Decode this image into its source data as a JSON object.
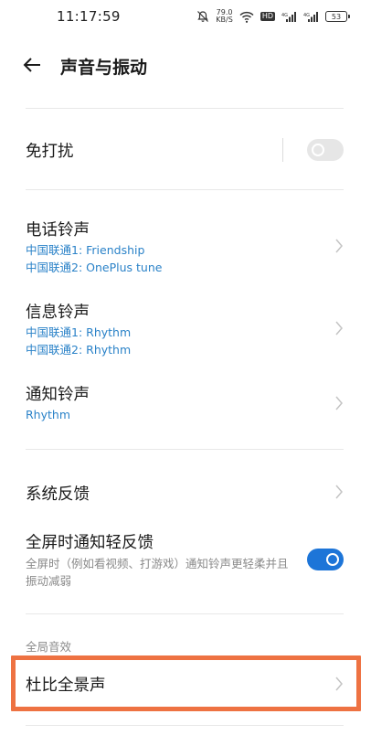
{
  "status_bar": {
    "time": "11:17:59",
    "net_speed_value": "79.0",
    "net_speed_unit": "KB/S",
    "hd_label": "HD",
    "battery_level": "53"
  },
  "header": {
    "title": "声音与振动"
  },
  "rows": {
    "dnd": {
      "title": "免打扰",
      "enabled": false
    },
    "phone_ringtone": {
      "title": "电话铃声",
      "sim1": "中国联通1: Friendship",
      "sim2": "中国联通2: OnePlus tune"
    },
    "message_ringtone": {
      "title": "信息铃声",
      "sim1": "中国联通1: Rhythm",
      "sim2": "中国联通2: Rhythm"
    },
    "notification_ringtone": {
      "title": "通知铃声",
      "value": "Rhythm"
    },
    "system_feedback": {
      "title": "系统反馈"
    },
    "fullscreen_feedback": {
      "title": "全屏时通知轻反馈",
      "description": "全屏时（例如看视频、打游戏）通知铃声更轻柔并且振动减弱",
      "enabled": true
    },
    "global_sound_section": "全局音效",
    "dolby": {
      "title": "杜比全景声"
    }
  },
  "colors": {
    "accent": "#1d75d8",
    "subtext_blue": "#2a82c8",
    "highlight": "#ee7242"
  }
}
